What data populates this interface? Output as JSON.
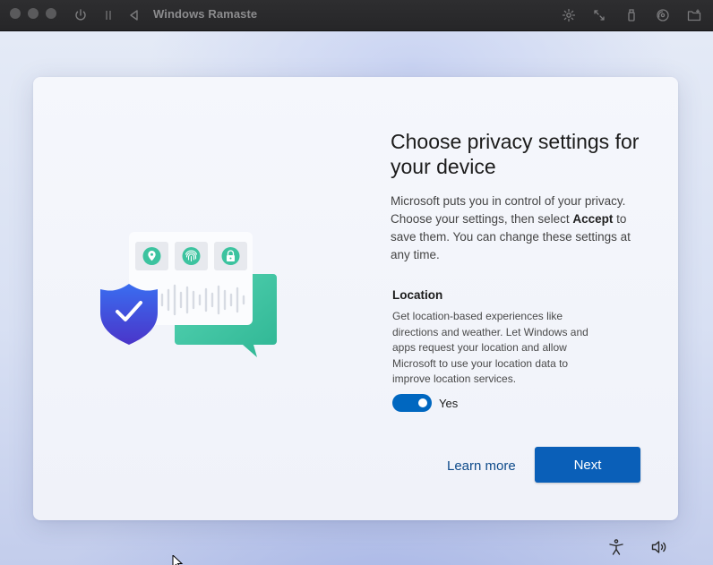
{
  "vm_window": {
    "title": "Windows Ramaste",
    "controls": [
      "power-icon",
      "pause-icon",
      "back-icon"
    ],
    "toolbar_icons": [
      "brightness-icon",
      "resize-icon",
      "usb-icon",
      "cd-icon",
      "shared-folder-icon"
    ]
  },
  "oobe": {
    "heading": "Choose privacy settings for your device",
    "description": {
      "part1": "Microsoft puts you in control of your privacy. Choose your settings, then select ",
      "accept": "Accept",
      "part2": " to save them. You can change these settings at any time."
    },
    "location": {
      "title": "Location",
      "description": "Get location-based experiences like directions and weather. Let Windows and apps request your location and allow Microsoft to use your location data to improve location services.",
      "toggle_on": true,
      "toggle_label": "Yes"
    },
    "learn_more": "Learn more",
    "next": "Next",
    "illustration_icons": [
      "location-pin-icon",
      "fingerprint-icon",
      "lock-icon",
      "shield-check-icon"
    ]
  },
  "system_icons": [
    "accessibility-icon",
    "volume-icon"
  ],
  "colors": {
    "accent": "#0a5fb8",
    "toggle": "#0067c0",
    "link": "#0d4a8a",
    "shield": "#3d4fd8",
    "chat_bubble": "#3fc7a4"
  }
}
